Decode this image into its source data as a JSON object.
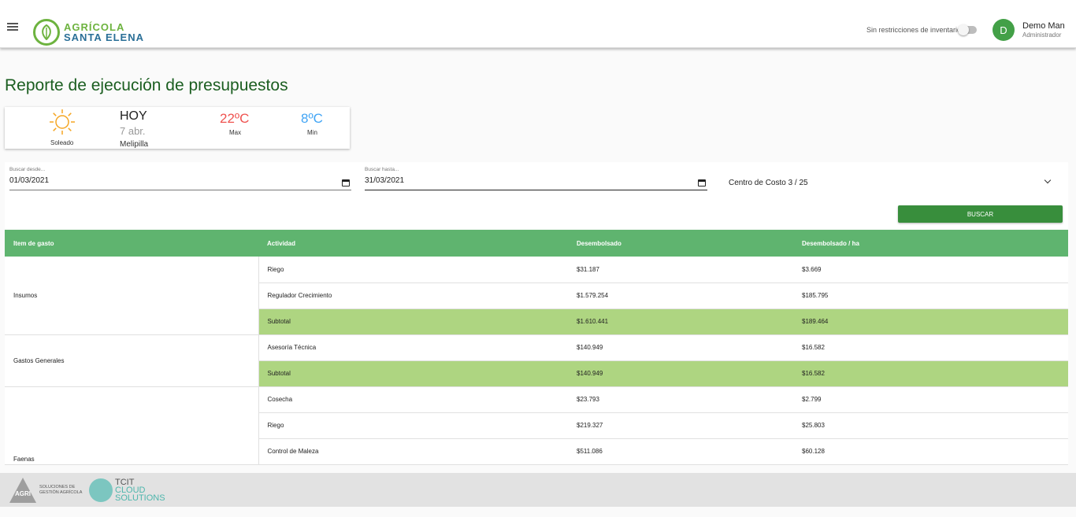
{
  "header": {
    "logo_line1": "AGRÍCOLA",
    "logo_line2": "SANTA ELENA",
    "toggle_label": "Sin restricciones de inventario",
    "avatar_initial": "D",
    "user_name": "Demo Man",
    "user_role": "Administrador"
  },
  "page": {
    "title": "Reporte de ejecución de presupuestos"
  },
  "weather": {
    "condition": "Soleado",
    "day": "HOY",
    "date": "7 abr.",
    "city": "Melipilla",
    "max_temp": "22ºC",
    "max_label": "Max",
    "min_temp": "8ºC",
    "min_label": "Min"
  },
  "filters": {
    "from_label": "Buscar desde...",
    "from_value": "01/03/2021",
    "to_label": "Buscar hasta...",
    "to_value": "31/03/2021",
    "cost_center": "Centro de Costo 3 / 25",
    "search_button": "BUSCAR"
  },
  "table": {
    "headers": [
      "Item de gasto",
      "Actividad",
      "Desembolsado",
      "Desembolsado / ha"
    ],
    "groups": [
      {
        "name": "Insumos",
        "rows": [
          {
            "actividad": "Riego",
            "desembolsado": "$31.187",
            "por_ha": "$3.669"
          },
          {
            "actividad": "Regulador Crecimiento",
            "desembolsado": "$1.579.254",
            "por_ha": "$185.795"
          },
          {
            "actividad": "Subtotal",
            "desembolsado": "$1.610.441",
            "por_ha": "$189.464"
          }
        ]
      },
      {
        "name": "Gastos Generales",
        "rows": [
          {
            "actividad": "Asesoría Técnica",
            "desembolsado": "$140.949",
            "por_ha": "$16.582"
          },
          {
            "actividad": "Subtotal",
            "desembolsado": "$140.949",
            "por_ha": "$16.582"
          }
        ]
      },
      {
        "name": "Faenas",
        "rows": [
          {
            "actividad": "Cosecha",
            "desembolsado": "$23.793",
            "por_ha": "$2.799"
          },
          {
            "actividad": "Riego",
            "desembolsado": "$219.327",
            "por_ha": "$25.803"
          },
          {
            "actividad": "Control de Maleza",
            "desembolsado": "$511.086",
            "por_ha": "$60.128"
          }
        ]
      }
    ]
  },
  "footer": {
    "agri_mark": "AGRI",
    "agri_text_1": "SOLUCIONES DE",
    "agri_text_2": "GESTIÓN AGRÍCOLA",
    "tcit_1": "TCIT",
    "tcit_2": "CLOUD",
    "tcit_3": "SOLUTIONS"
  },
  "colors": {
    "brand_green": "#6db33f",
    "header_row": "#5fb46f",
    "subtotal_row": "#aed581",
    "button": "#388e3c",
    "max_temp": "#ef5350",
    "min_temp": "#42a5f5"
  },
  "icons": [
    "menu-icon",
    "leaf-logo-icon",
    "sun-icon",
    "calendar-icon",
    "chevron-down-icon"
  ]
}
